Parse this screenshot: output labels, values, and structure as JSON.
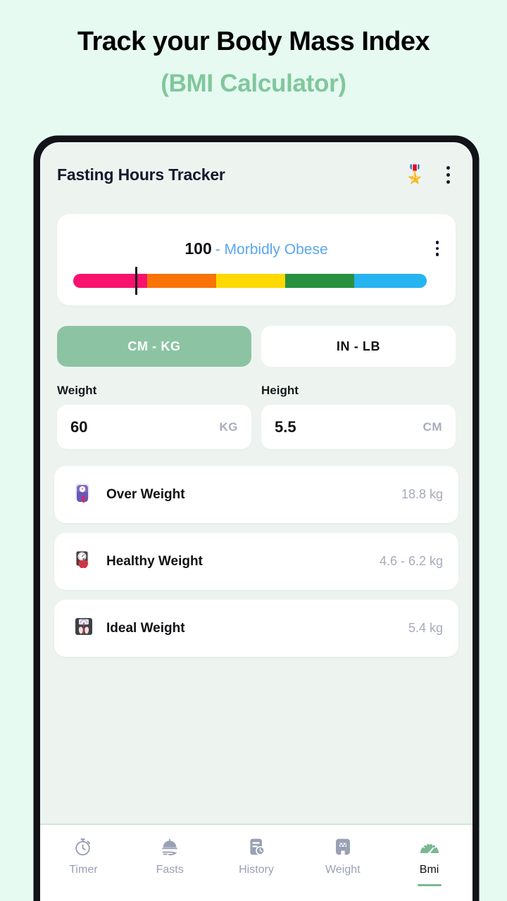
{
  "promo": {
    "line1": "Track your Body Mass Index",
    "line2": "(BMI Calculator)",
    "accent_color": "#80c79c"
  },
  "appbar": {
    "title": "Fasting Hours Tracker",
    "badge_icon": "medal-badge-icon",
    "badge_glyph": "🎖️",
    "menu_icon": "kebab-menu-icon"
  },
  "bmi_card": {
    "value": "100",
    "category": "- Morbidly Obese",
    "category_color": "#5aa6f0",
    "menu_icon": "kebab-menu-icon",
    "marker_position_pct": 17.5,
    "scale_segments": [
      {
        "name": "morbidly-obese",
        "color": "#f8126e",
        "width_pct": 21
      },
      {
        "name": "obese",
        "color": "#f97306",
        "width_pct": 19.5
      },
      {
        "name": "overweight",
        "color": "#ffd900",
        "width_pct": 19.5
      },
      {
        "name": "healthy",
        "color": "#28913f",
        "width_pct": 19.5
      },
      {
        "name": "underweight",
        "color": "#26b4f0",
        "width_pct": 20.5
      }
    ]
  },
  "units": {
    "options": [
      {
        "label": "CM - KG",
        "active": true
      },
      {
        "label": "IN - LB",
        "active": false
      }
    ],
    "active_bg": "#8cc4a3"
  },
  "inputs": {
    "weight": {
      "label": "Weight",
      "value": "60",
      "unit": "KG",
      "placeholder": "0"
    },
    "height": {
      "label": "Height",
      "value": "5.5",
      "unit": "CM",
      "placeholder": "0"
    }
  },
  "results": [
    {
      "icon_name": "weight-scale-up-arrow-icon",
      "icon_glyph": "⚖️",
      "name": "Over Weight",
      "value": "18.8 kg"
    },
    {
      "icon_name": "scale-apple-icon",
      "icon_glyph": "🍎",
      "name": "Healthy Weight",
      "value": "4.6 - 6.2 kg"
    },
    {
      "icon_name": "scale-feet-icon",
      "icon_glyph": "🧍",
      "name": "Ideal Weight",
      "value": "5.4 kg"
    }
  ],
  "bottom_nav": {
    "items": [
      {
        "label": "Timer",
        "icon_name": "stopwatch-icon",
        "active": false
      },
      {
        "label": "Fasts",
        "icon_name": "food-cloche-icon",
        "active": false
      },
      {
        "label": "History",
        "icon_name": "history-clock-icon",
        "active": false
      },
      {
        "label": "Weight",
        "icon_name": "weight-scale-icon",
        "active": false
      },
      {
        "label": "Bmi",
        "icon_name": "speedometer-icon",
        "active": true
      }
    ],
    "active_color": "#79b894",
    "inactive_color": "#9aa0b5"
  }
}
